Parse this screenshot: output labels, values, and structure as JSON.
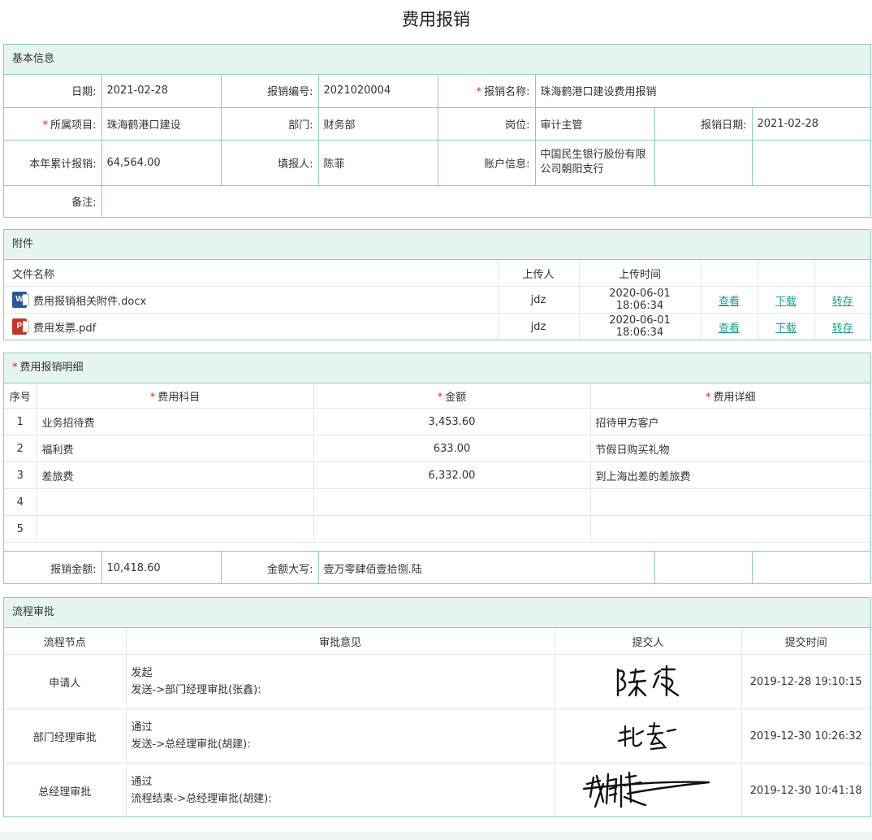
{
  "page_title": "费用报销",
  "basic": {
    "section_title": "基本信息",
    "date_label": "日期:",
    "date_value": "2021-02-28",
    "number_label": "报销编号:",
    "number_value": "2021020004",
    "name_label": "报销名称:",
    "name_value": "珠海鹤港口建设费用报销",
    "project_label": "所属项目:",
    "project_value": "珠海鹤港口建设",
    "dept_label": "部门:",
    "dept_value": "财务部",
    "post_label": "岗位:",
    "post_value": "审计主管",
    "reimb_date_label": "报销日期:",
    "reimb_date_value": "2021-02-28",
    "ytd_label": "本年累计报销:",
    "ytd_value": "64,564.00",
    "filler_label": "填报人:",
    "filler_value": "陈菲",
    "account_label": "账户信息:",
    "account_value": "中国民生银行股份有限公司朝阳支行",
    "remark_label": "备注:",
    "remark_value": ""
  },
  "attachments": {
    "section_title": "附件",
    "headers": {
      "file": "文件名称",
      "uploader": "上传人",
      "time": "上传时间"
    },
    "files": [
      {
        "name": "费用报销相关附件.docx",
        "icon": "word-file-icon",
        "uploader": "jdz",
        "time": "2020-06-01 18:06:34",
        "view": "查看",
        "download": "下载",
        "transfer": "转存"
      },
      {
        "name": "费用发票.pdf",
        "icon": "pdf-file-icon",
        "uploader": "jdz",
        "time": "2020-06-01 18:06:34",
        "view": "查看",
        "download": "下载",
        "transfer": "转存"
      }
    ]
  },
  "expenses": {
    "section_title": "费用报销明细",
    "headers": {
      "index": "序号",
      "item": "费用科目",
      "amount": "金额",
      "detail": "费用详细"
    },
    "rows": [
      {
        "index": "1",
        "item": "业务招待费",
        "amount": "3,453.60",
        "detail": "招待甲方客户"
      },
      {
        "index": "2",
        "item": "福利费",
        "amount": "633.00",
        "detail": "节假日购买礼物"
      },
      {
        "index": "3",
        "item": "差旅费",
        "amount": "6,332.00",
        "detail": "到上海出差的差旅费"
      },
      {
        "index": "4",
        "item": "",
        "amount": "",
        "detail": ""
      },
      {
        "index": "5",
        "item": "",
        "amount": "",
        "detail": ""
      }
    ],
    "total_label": "报销金额:",
    "total_value": "10,418.60",
    "capital_label": "金额大写:",
    "capital_value": "壹万零肆佰壹拾捌.陆"
  },
  "approval": {
    "section_title": "流程审批",
    "headers": {
      "node": "流程节点",
      "opinion": "审批意见",
      "submitter": "提交人",
      "time": "提交时间"
    },
    "rows": [
      {
        "node": "申请人",
        "opinion1": "发起",
        "opinion2": "发送->部门经理审批(张鑫):",
        "signature": "signature-chen-fei",
        "time": "2019-12-28 19:10:15"
      },
      {
        "node": "部门经理审批",
        "opinion1": "通过",
        "opinion2": "发送->总经理审批(胡建):",
        "signature": "signature-zhang-xin",
        "time": "2019-12-30 10:26:32"
      },
      {
        "node": "总经理审批",
        "opinion1": "通过",
        "opinion2": "流程结束->总经理审批(胡建):",
        "signature": "signature-hu-jian",
        "time": "2019-12-30 10:41:18"
      }
    ]
  },
  "colors": {
    "border": "#8cc9c3",
    "header_bg": "#e6f4f2",
    "link": "#1d9d86",
    "required": "#e02020"
  }
}
